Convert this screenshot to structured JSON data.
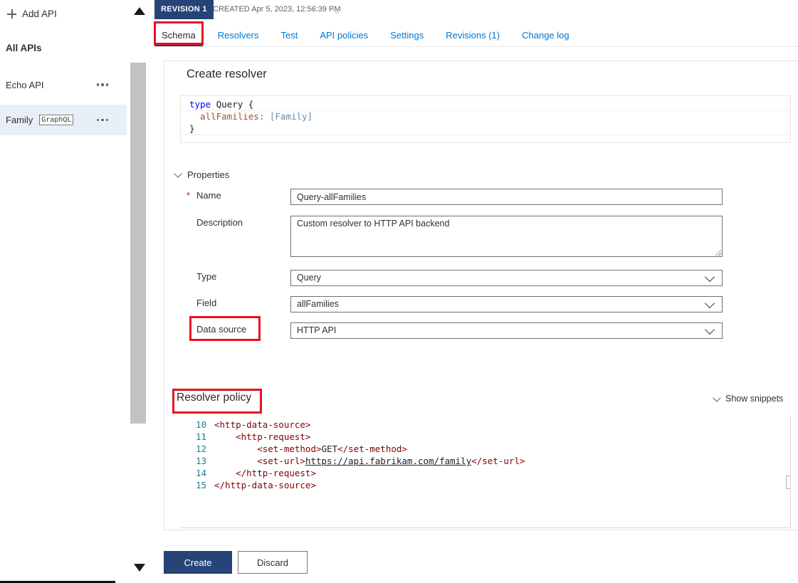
{
  "sidebar": {
    "add_api_label": "Add API",
    "all_apis_heading": "All APIs",
    "apis": [
      {
        "name": "Echo API"
      },
      {
        "name": "Family",
        "badge": "GraphQL"
      }
    ]
  },
  "revision_bar": {
    "badge": "REVISION 1",
    "created_text": "CREATED Apr 5, 2023, 12:56:39 PM"
  },
  "tabs": [
    {
      "label": "Schema",
      "active": true
    },
    {
      "label": "Resolvers",
      "active": false
    },
    {
      "label": "Test",
      "active": false
    },
    {
      "label": "API policies",
      "active": false
    },
    {
      "label": "Settings",
      "active": false
    },
    {
      "label": "Revisions (1)",
      "active": false
    },
    {
      "label": "Change log",
      "active": false
    }
  ],
  "create_resolver": {
    "title": "Create resolver",
    "schema_code": {
      "lines": [
        {
          "segments": [
            {
              "text": "type",
              "style": "keyword"
            },
            {
              "text": " Query {",
              "style": "plain"
            }
          ]
        },
        {
          "segments": [
            {
              "text": "  allFamilies:",
              "style": "field"
            },
            {
              "text": " [Family]",
              "style": "typeref"
            }
          ]
        },
        {
          "segments": [
            {
              "text": "}",
              "style": "plain"
            }
          ]
        }
      ]
    },
    "properties_label": "Properties",
    "fields": {
      "name": {
        "label": "Name",
        "required_marker": "*",
        "value": "Query-allFamilies"
      },
      "description": {
        "label": "Description",
        "value": "Custom resolver to HTTP API backend"
      },
      "type": {
        "label": "Type",
        "value": "Query"
      },
      "field": {
        "label": "Field",
        "value": "allFamilies"
      },
      "data_source": {
        "label": "Data source",
        "value": "HTTP API"
      }
    },
    "policy": {
      "heading": "Resolver policy",
      "show_snippets_label": "Show snippets",
      "code_lines": [
        {
          "num": "10",
          "segments": [
            {
              "text": "<http-data-source>",
              "style": "tag"
            }
          ]
        },
        {
          "num": "11",
          "segments": [
            {
              "text": "    <http-request>",
              "style": "tag"
            }
          ]
        },
        {
          "num": "12",
          "segments": [
            {
              "text": "        <set-method>",
              "style": "tag"
            },
            {
              "text": "GET",
              "style": "plain"
            },
            {
              "text": "</set-method>",
              "style": "tag"
            }
          ]
        },
        {
          "num": "13",
          "segments": [
            {
              "text": "        <set-url>",
              "style": "tag"
            },
            {
              "text": "https://api.fabrikam.com/family",
              "style": "link"
            },
            {
              "text": "</set-url>",
              "style": "tag"
            }
          ]
        },
        {
          "num": "14",
          "segments": [
            {
              "text": "    </http-request>",
              "style": "tag"
            }
          ]
        },
        {
          "num": "15",
          "segments": [
            {
              "text": "</http-data-source>",
              "style": "tag"
            }
          ]
        }
      ]
    },
    "buttons": {
      "create_label": "Create",
      "discard_label": "Discard"
    }
  },
  "colors": {
    "primary_navy": "#264478",
    "link_blue": "#0078d4",
    "annotation_red": "#e81123",
    "selected_row_bg": "#e8eff7"
  }
}
